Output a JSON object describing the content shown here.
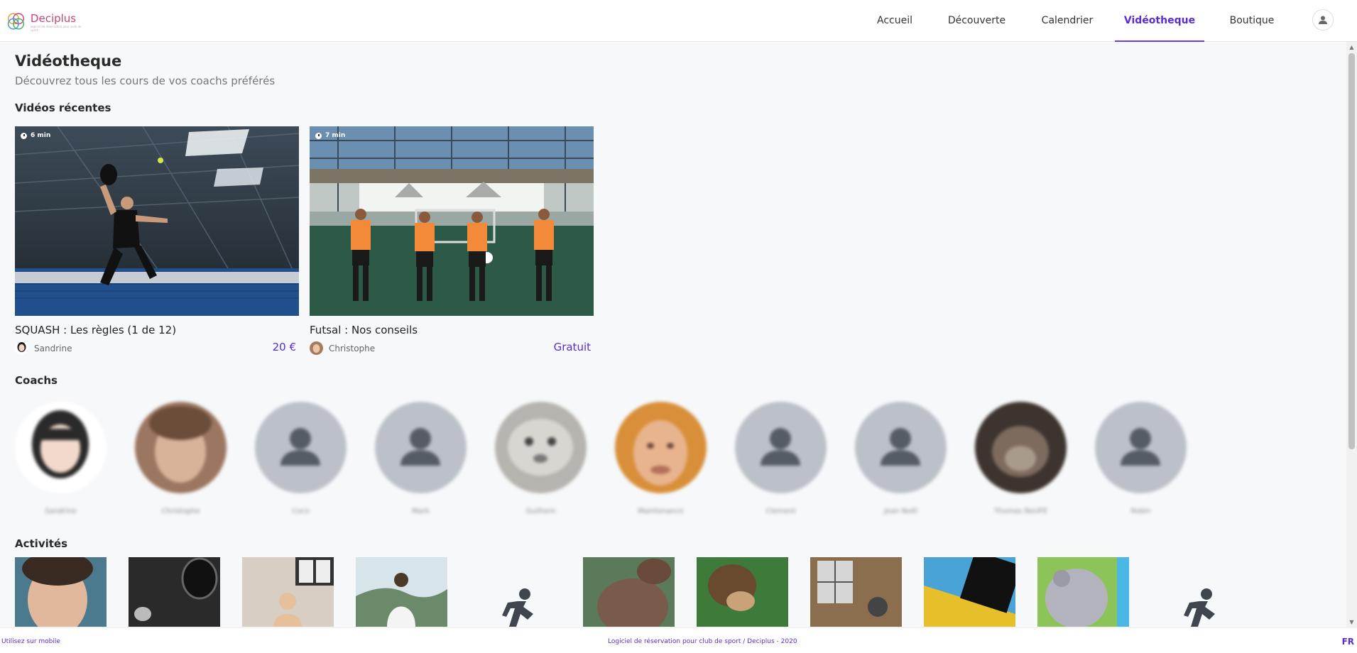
{
  "brand": {
    "name": "Deciplus",
    "tagline": "logiciel de réservation pour salle de sport"
  },
  "nav": {
    "items": [
      {
        "label": "Accueil",
        "active": false
      },
      {
        "label": "Découverte",
        "active": false
      },
      {
        "label": "Calendrier",
        "active": false
      },
      {
        "label": "Vidéotheque",
        "active": true
      },
      {
        "label": "Boutique",
        "active": false
      }
    ],
    "user_icon": "user-icon",
    "accent_color": "#5a2bd6"
  },
  "page": {
    "title": "Vidéotheque",
    "subtitle": "Découvrez tous les cours de vos coachs préférés"
  },
  "sections": {
    "recent": "Vidéos récentes",
    "coachs": "Coachs",
    "activities": "Activités"
  },
  "videos": [
    {
      "duration": "6 min",
      "title": "SQUASH : Les règles (1 de 12)",
      "coach": "Sandrine",
      "price": "20 €"
    },
    {
      "duration": "7 min",
      "title": "Futsal : Nos conseils",
      "coach": "Christophe",
      "price": "Gratuit"
    }
  ],
  "coaches": [
    {
      "name": "Sandrine"
    },
    {
      "name": "Christophe"
    },
    {
      "name": "Coco"
    },
    {
      "name": "Mark"
    },
    {
      "name": "Guilhem"
    },
    {
      "name": "Maintenance"
    },
    {
      "name": "Clement"
    },
    {
      "name": "Jean Noël"
    },
    {
      "name": "Thomas BeUFE"
    },
    {
      "name": "Robin"
    }
  ],
  "activities_icons": [
    "running-person-icon",
    "running-person-icon"
  ],
  "footer": {
    "mobile": "Utilisez sur mobile",
    "copyright": "Logiciel de réservation pour club de sport / Deciplus - 2020",
    "lang": "FR"
  }
}
